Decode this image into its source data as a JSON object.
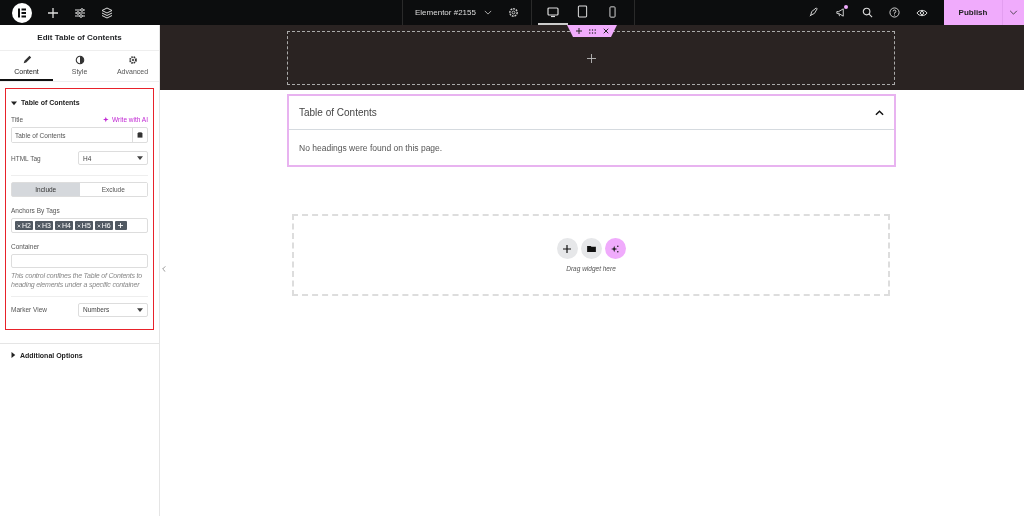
{
  "topbar": {
    "document_title": "Elementor #2155",
    "devices": [
      {
        "kind": "desktop",
        "selected": true
      },
      {
        "kind": "tablet",
        "selected": false
      },
      {
        "kind": "mobile",
        "selected": false
      }
    ],
    "notification_dot": true,
    "publish": "Publish"
  },
  "panel": {
    "title": "Edit Table of Contents",
    "tabs": [
      {
        "label": "Content",
        "kind": "pencil",
        "selected": true
      },
      {
        "label": "Style",
        "kind": "contrast",
        "selected": false
      },
      {
        "label": "Advanced",
        "kind": "gear",
        "selected": false
      }
    ],
    "section": {
      "title": "Table of Contents",
      "expanded": true,
      "title_label": "Title",
      "ai_link": "Write with AI",
      "title_value": "Table of Contents",
      "html_tag_label": "HTML Tag",
      "html_tag_value": "H4",
      "mode_tabs": [
        {
          "label": "Include",
          "selected": true
        },
        {
          "label": "Exclude",
          "selected": false
        }
      ],
      "anchors_label": "Anchors By Tags",
      "anchor_tags": [
        "H2",
        "H3",
        "H4",
        "H5",
        "H6"
      ],
      "container_label": "Container",
      "container_note": "This control confines the Table of Contents to heading elements under a specific container",
      "marker_label": "Marker View",
      "marker_value": "Numbers"
    },
    "collapsed_sections": [
      {
        "title": "Additional Options",
        "expanded": false
      }
    ]
  },
  "canvas": {
    "widget": {
      "title": "Table of Contents",
      "expanded": true,
      "message": "No headings were found on this page."
    },
    "drop_zone": {
      "hint": "Drag widget here"
    }
  }
}
